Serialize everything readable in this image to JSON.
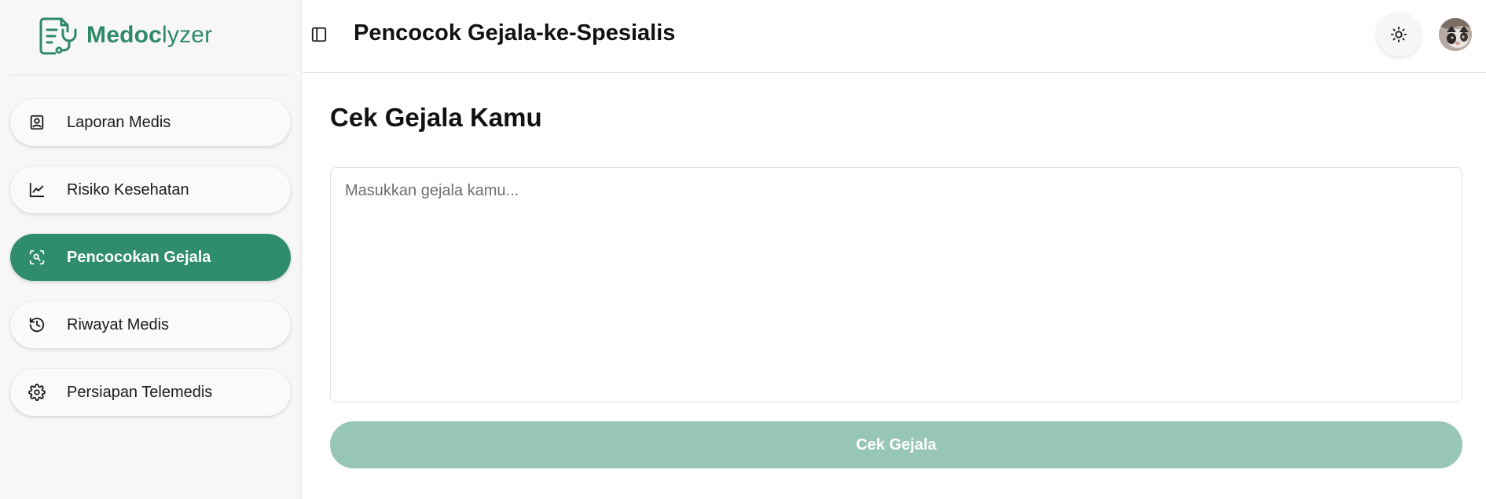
{
  "brand": {
    "name_accent": "Medoc",
    "name_rest": "lyzer",
    "color": "#2f8a68"
  },
  "sidebar": {
    "items": [
      {
        "label": "Laporan Medis",
        "icon": "report-icon",
        "active": false
      },
      {
        "label": "Risiko Kesehatan",
        "icon": "line-chart-icon",
        "active": false
      },
      {
        "label": "Pencocokan Gejala",
        "icon": "scan-search-icon",
        "active": true
      },
      {
        "label": "Riwayat Medis",
        "icon": "history-icon",
        "active": false
      },
      {
        "label": "Persiapan Telemedis",
        "icon": "gear-icon",
        "active": false
      }
    ]
  },
  "header": {
    "title": "Pencocok Gejala-ke-Spesialis",
    "theme_icon": "sun-icon",
    "toggle_icon": "sidebar-toggle-icon"
  },
  "main": {
    "section_title": "Cek Gejala Kamu",
    "input_placeholder": "Masukkan gejala kamu...",
    "input_value": "",
    "button_label": "Cek Gejala"
  },
  "colors": {
    "primary": "#2f8d6b",
    "primary_disabled": "#97c6b5"
  }
}
